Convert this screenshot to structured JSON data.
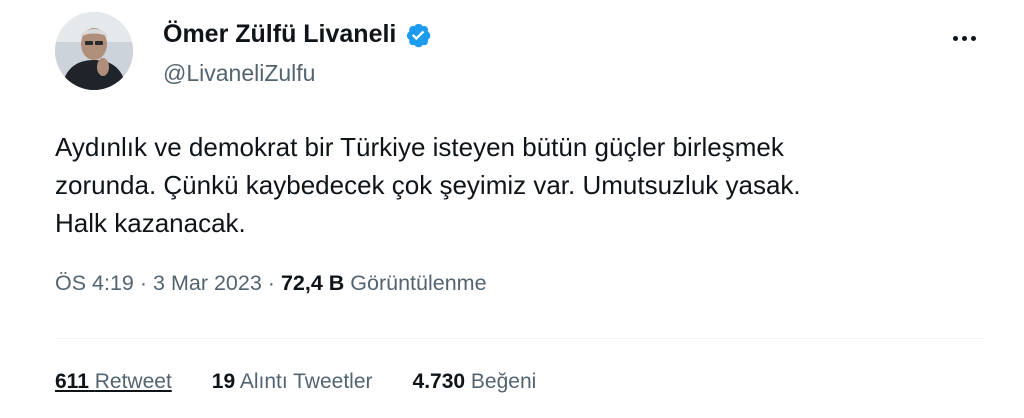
{
  "author": {
    "name": "Ömer Zülfü Livaneli",
    "handle": "@LivaneliZulfu"
  },
  "tweet": {
    "lines": [
      "Aydınlık ve demokrat bir Türkiye isteyen bütün güçler birleşmek",
      "zorunda. Çünkü kaybedecek çok şeyimiz var.  Umutsuzluk yasak.",
      "Halk kazanacak."
    ]
  },
  "meta": {
    "time": "ÖS 4:19",
    "sep1": "·",
    "date": "3 Mar 2023",
    "sep2": "·",
    "views_count": "72,4 B",
    "views_label": "Görüntülenme"
  },
  "stats": {
    "retweets_count": "611",
    "retweets_label": "Retweet",
    "quotes_count": "19",
    "quotes_label": "Alıntı Tweetler",
    "likes_count": "4.730",
    "likes_label": "Beğeni"
  },
  "icons": {
    "verified": "verified-badge-icon",
    "more": "more-dots-icon"
  },
  "colors": {
    "text": "#0f1419",
    "secondary": "#536471",
    "verified": "#1d9bf0",
    "divider": "#eff3f4"
  }
}
